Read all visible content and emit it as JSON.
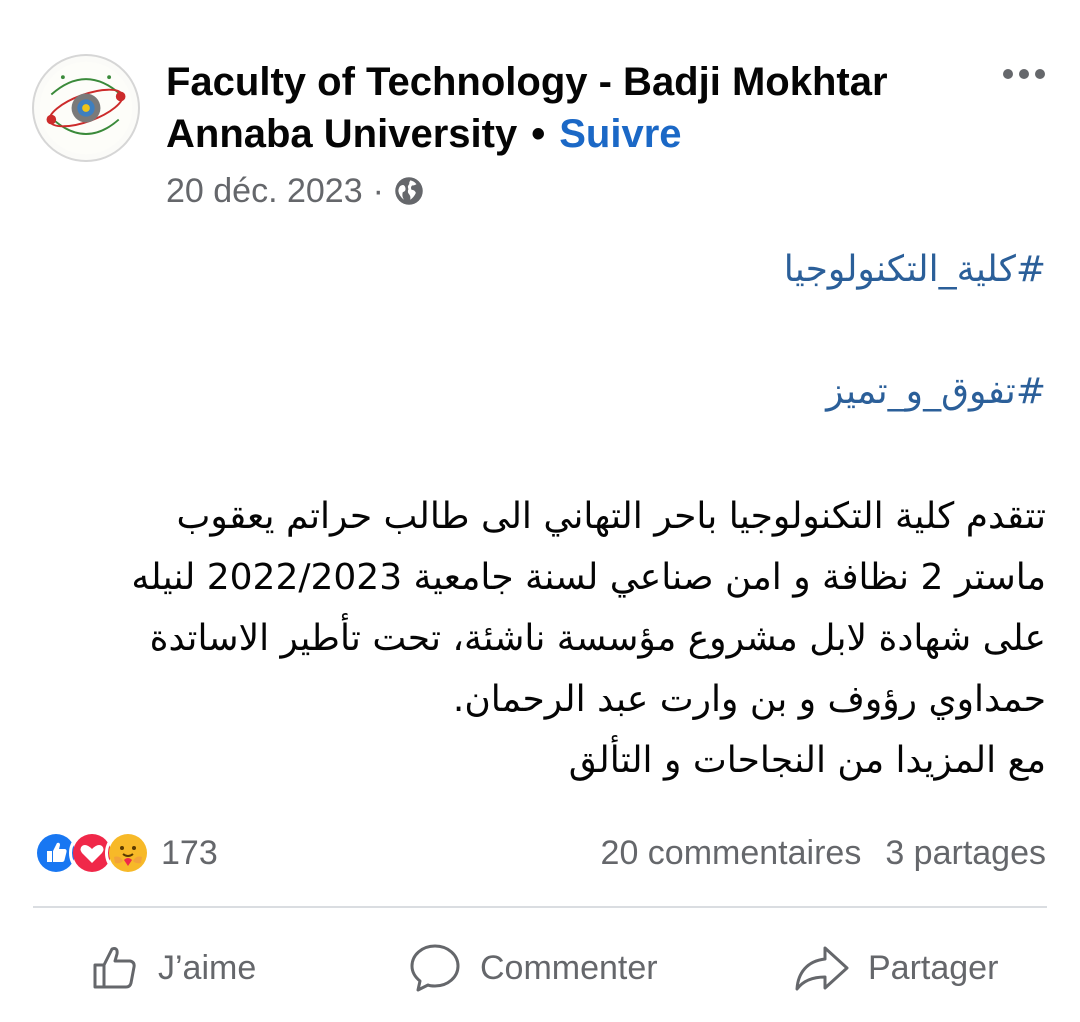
{
  "page": {
    "name": "Faculty of Technology - Badji Mokhtar Annaba University",
    "separator": "•",
    "follow_label": "Suivre"
  },
  "post": {
    "date": "20 déc. 2023",
    "dot": "·",
    "visibility_icon": "globe-icon",
    "hashtags": [
      "#كلية_التكنولوجيا",
      "#تفوق_و_تميز"
    ],
    "lines": [
      "تتقدم كلية التكنولوجيا باحر التهاني الى طالب حراتم يعقوب",
      "ماستر 2 نظافة و امن صناعي لسنة جامعية 2022/2023   لنيله",
      "على شهادة  لابل مشروع مؤسسة ناشئة، تحت تأطير الاساتدة",
      "حمداوي رؤوف و بن وارت عبد الرحمان.",
      "مع المزيدا من النجاحات و التألق"
    ]
  },
  "reactions": {
    "icons": [
      "like-icon",
      "love-icon",
      "care-icon"
    ],
    "count": "173",
    "comments": "20 commentaires",
    "shares": "3 partages"
  },
  "actions": {
    "like": "J’aime",
    "comment": "Commenter",
    "share": "Partager"
  },
  "colors": {
    "accent": "#1b68c6",
    "hashtag": "#2b5f99",
    "muted": "#65676b",
    "like": "#1877f2",
    "love": "#f02849",
    "care": "#f7b928"
  }
}
